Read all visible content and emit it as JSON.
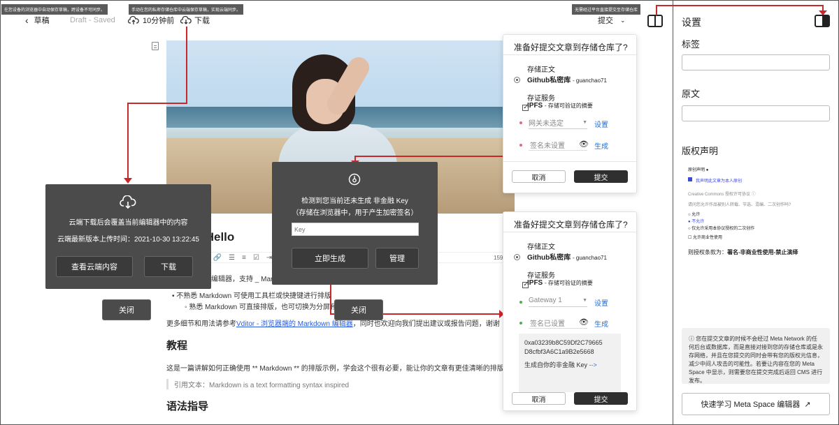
{
  "notes": {
    "local_autosave": "在您设备的浏览器中自动保存草稿，跨设备不可同步。",
    "cloud_save": "手动在您的私密存储仓库中云端保存草稿，实现云端同步。",
    "direct_submit": "无需经过平台直接提交至存储仓库"
  },
  "topbar": {
    "back_label": "草稿",
    "draft_status": "Draft - Saved",
    "cloud_time": "10分钟前",
    "download_label": "下载",
    "submit_label": "提交"
  },
  "article": {
    "title": "编辑器 Hello",
    "line1": "编辑器，支持 _ Markdown _。",
    "bullet1": "不熟悉 Markdown 可使用工具栏或快捷键进行排版",
    "bullet2": "熟悉 Markdown 可直接排版，也可切换为分屏预览",
    "more_prefix": "更多细节和用法请参考",
    "more_link": "Vditor - 浏览器端的 Markdown 编辑器",
    "more_suffix": "，同时也欢迎向我们提出建议或报告问题，谢谢",
    "h_tutorial": "教程",
    "tutorial_text": "这是一篇讲解如何正确使用 ** Markdown ** 的排版示例，学会这个很有必要，能让你的文章有更佳清晰的排版",
    "quote": "引用文本：Markdown is a text formatting syntax inspired",
    "h_syntax": "语法指导",
    "toolbar_count": "159"
  },
  "cloud_dialog": {
    "line1": "云端下载后会覆盖当前编辑器中的内容",
    "line2": "云端最新版本上传时间：2021-10-30 13:22:45",
    "view_button": "查看云端内容",
    "download_button": "下载",
    "close_button": "关闭"
  },
  "key_dialog": {
    "line1": "检测到您当前还未生成 非金融 Key",
    "line2": "（存储在浏览器中，用于产生加密签名）",
    "placeholder": "Key",
    "generate_button": "立即生成",
    "manage_button": "管理",
    "close_button": "关闭"
  },
  "submit_panel_1": {
    "title": "准备好提交文章到存储仓库了?",
    "storage_label": "存储正文",
    "storage_value": "Github私密库",
    "storage_user": "- guanchao71",
    "service_label": "存证服务",
    "service_value": "IPFS",
    "service_desc": "- 存储可验证的摘要",
    "gateway_value": "网关未选定",
    "gateway_link": "设置",
    "sign_value": "签名未设置",
    "sign_link": "生成",
    "cancel": "取消",
    "submit": "提交"
  },
  "submit_panel_2": {
    "title": "准备好提交文章到存储仓库了?",
    "storage_label": "存储正文",
    "storage_value": "Github私密库",
    "storage_user": "- guanchao71",
    "service_label": "存证服务",
    "service_value": "IPFS",
    "service_desc": "- 存储可验证的摘要",
    "gateway_value": "Gateway 1",
    "gateway_link": "设置",
    "sign_value": "签名已设置",
    "sign_link": "生成",
    "key_line1": "0xa03239b8C59Df2C79665",
    "key_line2": "D8cfbf3A6C1a9B2e5668",
    "key_gen": "生成自你的非金融 Key",
    "key_arrow": "-->",
    "cancel": "取消",
    "submit": "提交"
  },
  "sidebar": {
    "title": "设置",
    "tags_label": "标签",
    "source_label": "原文",
    "copyright_label": "版权声明",
    "original_label": "原创声明",
    "original_check": "我声明此文章为本人原创",
    "cc_label": "Creative Commons 授权许可协议",
    "cc_question": "请问您允许作品被别人转载、节选、混编、二次创作吗?",
    "opt_allow": "允许",
    "opt_deny": "不允许",
    "opt_share": "仅允许采用本协议授权的二次创作",
    "opt_commercial": "允许商业性使用",
    "license_prefix": "则授权条款为：",
    "license_value": "署名-非商业性使用-禁止演绎",
    "info_text": "您在提交文章的时候不会经过 Meta Network 的任何后台或数据库，而是直接对接到您的存储仓库或是永存网络，并且在您提交的同时会带有您的版权元信息，减少中间人攻击的可能性。若要让内容在您的 Meta Space 中显示，则需要您在提交完成后返回 CMS 进行发布。",
    "learn_button": "快速学习 Meta Space 编辑器"
  },
  "colors": {
    "annotation_line": "#c8282a",
    "dialog_bg": "#4b4b4b",
    "link_blue": "#2a6fd6"
  }
}
